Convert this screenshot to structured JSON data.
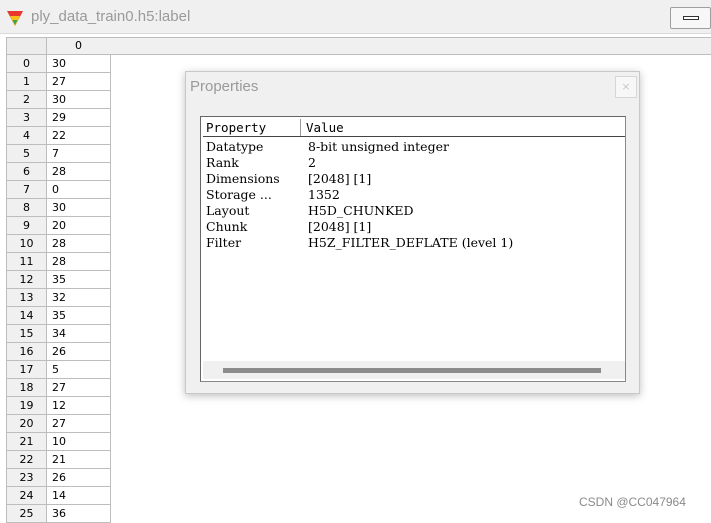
{
  "window": {
    "title": "ply_data_train0.h5:label"
  },
  "table": {
    "column_header": "0",
    "rows": [
      {
        "index": "0",
        "value": "30"
      },
      {
        "index": "1",
        "value": "27"
      },
      {
        "index": "2",
        "value": "30"
      },
      {
        "index": "3",
        "value": "29"
      },
      {
        "index": "4",
        "value": "22"
      },
      {
        "index": "5",
        "value": "7"
      },
      {
        "index": "6",
        "value": "28"
      },
      {
        "index": "7",
        "value": "0"
      },
      {
        "index": "8",
        "value": "30"
      },
      {
        "index": "9",
        "value": "20"
      },
      {
        "index": "10",
        "value": "28"
      },
      {
        "index": "11",
        "value": "28"
      },
      {
        "index": "12",
        "value": "35"
      },
      {
        "index": "13",
        "value": "32"
      },
      {
        "index": "14",
        "value": "35"
      },
      {
        "index": "15",
        "value": "34"
      },
      {
        "index": "16",
        "value": "26"
      },
      {
        "index": "17",
        "value": "5"
      },
      {
        "index": "18",
        "value": "27"
      },
      {
        "index": "19",
        "value": "12"
      },
      {
        "index": "20",
        "value": "27"
      },
      {
        "index": "21",
        "value": "10"
      },
      {
        "index": "22",
        "value": "21"
      },
      {
        "index": "23",
        "value": "26"
      },
      {
        "index": "24",
        "value": "14"
      },
      {
        "index": "25",
        "value": "36"
      }
    ]
  },
  "dialog": {
    "title": "Properties",
    "close_label": "×",
    "headers": {
      "property": "Property",
      "value": "Value"
    },
    "properties": [
      {
        "key": "Datatype",
        "value": "8-bit unsigned integer"
      },
      {
        "key": "Rank",
        "value": "2"
      },
      {
        "key": "Dimensions",
        "value": "[2048] [1]"
      },
      {
        "key": "Storage ...",
        "value": "1352"
      },
      {
        "key": "Layout",
        "value": "H5D_CHUNKED"
      },
      {
        "key": "Chunk",
        "value": "[2048] [1]"
      },
      {
        "key": "Filter",
        "value": "H5Z_FILTER_DEFLATE (level 1)"
      }
    ]
  },
  "watermark": "CSDN @CC047964",
  "colors": {
    "title_text": "#9a9a9a",
    "grid_border": "#bdbdbd",
    "dialog_bg": "#f0f0f0"
  }
}
